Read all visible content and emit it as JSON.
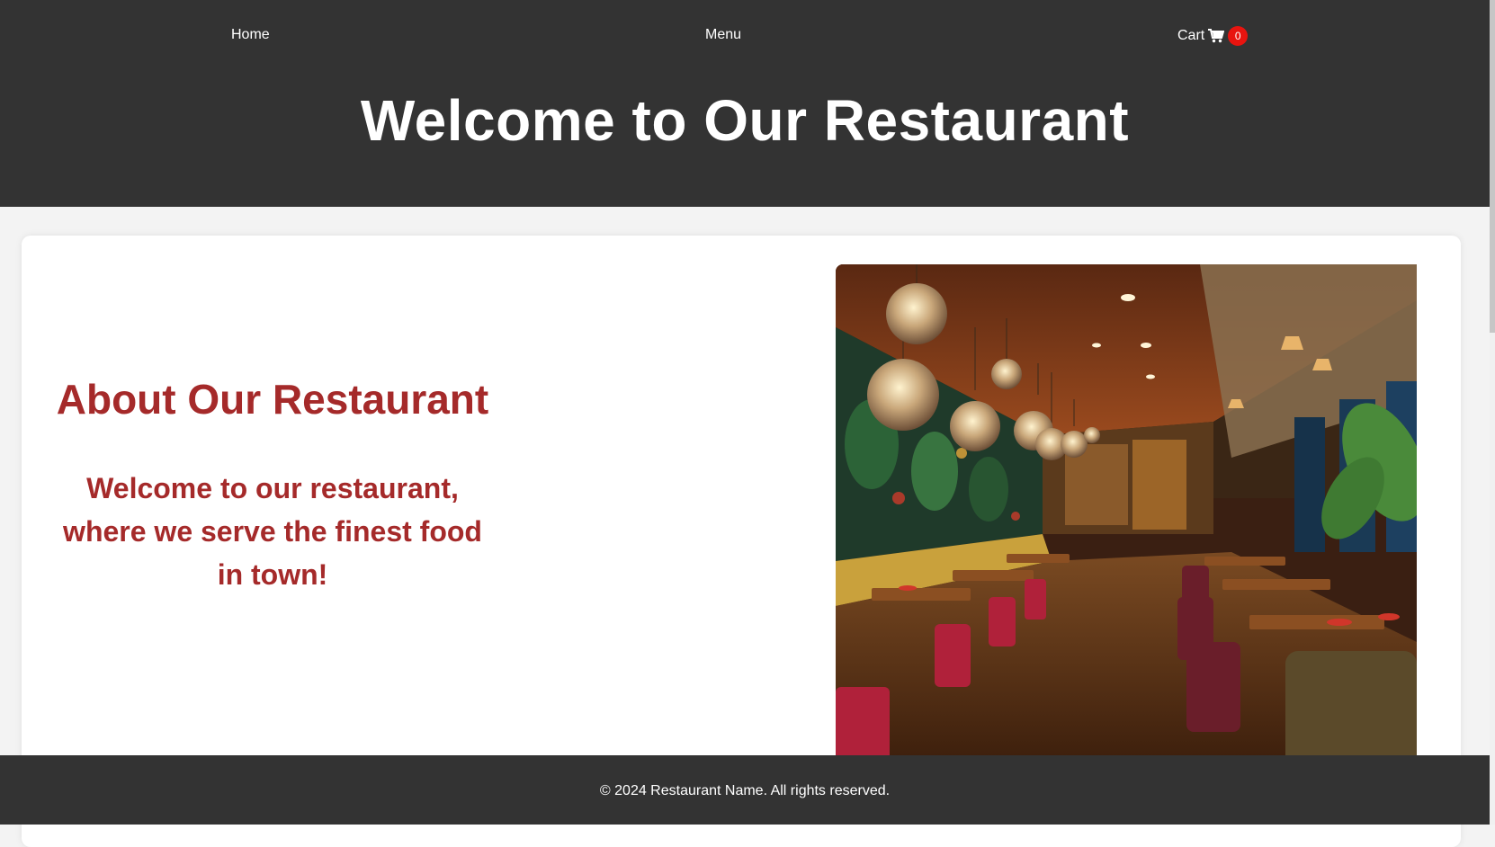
{
  "nav": {
    "home_label": "Home",
    "menu_label": "Menu",
    "cart_label": "Cart",
    "cart_icon": "shopping-cart-icon",
    "cart_count": "0"
  },
  "header": {
    "title": "Welcome to Our Restaurant"
  },
  "about": {
    "title": "About Our Restaurant",
    "text": "Welcome to our restaurant, where we serve the finest food in town!"
  },
  "footer": {
    "text": "© 2024 Restaurant Name. All rights reserved."
  },
  "colors": {
    "header_bg": "#333333",
    "accent": "#a52a2a",
    "badge": "#e8140f"
  }
}
